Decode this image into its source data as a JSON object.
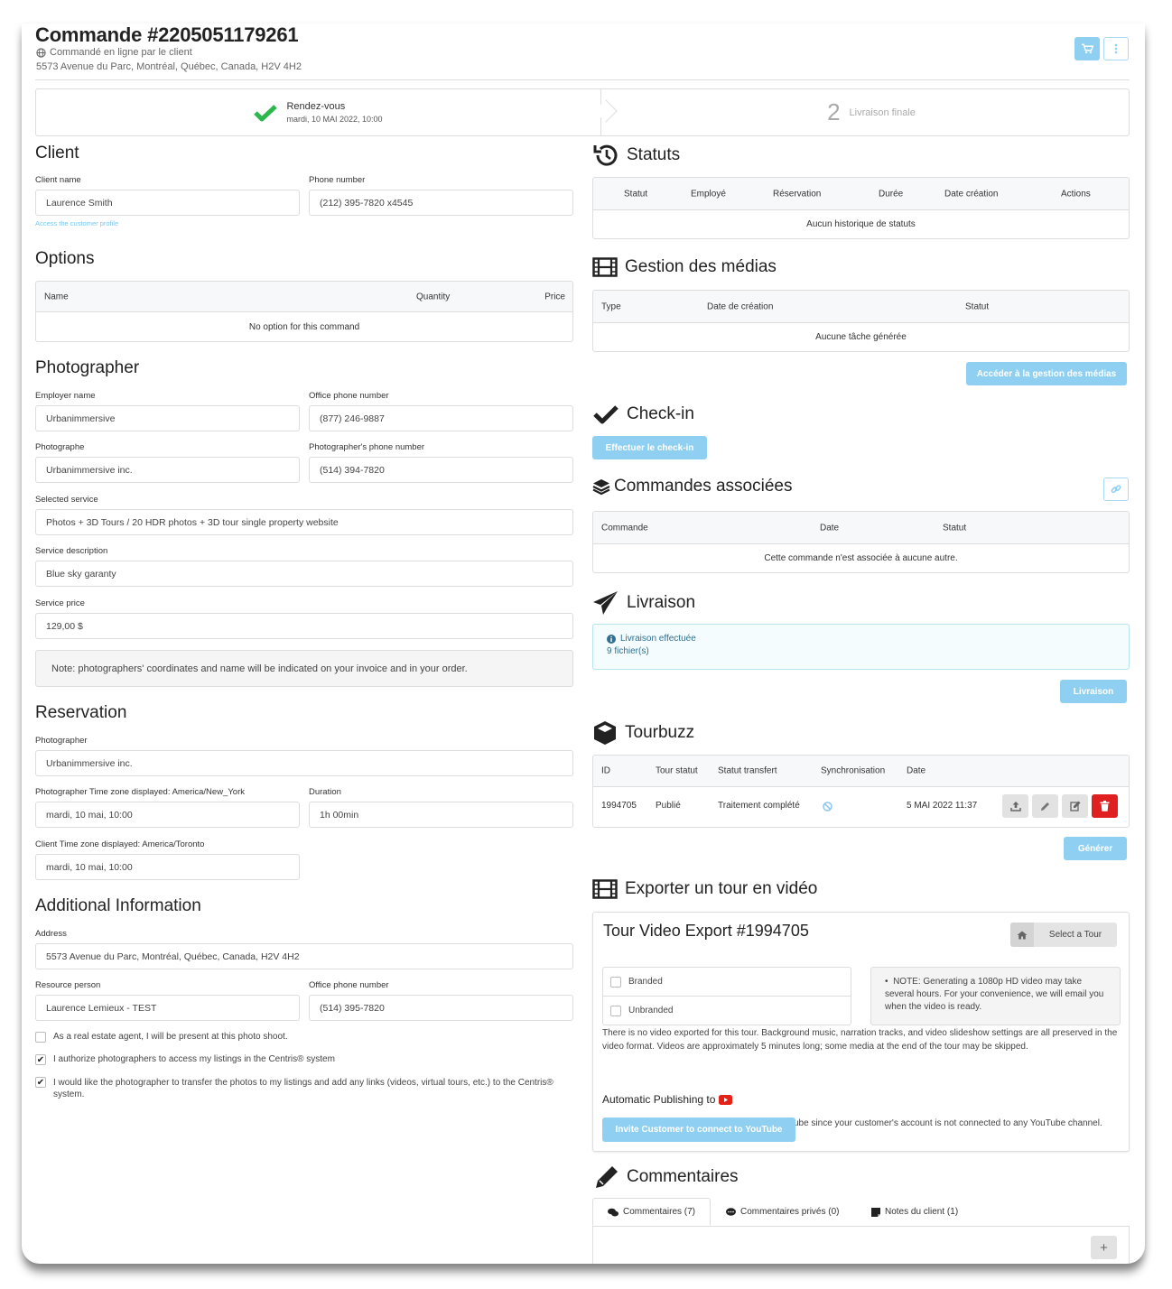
{
  "header": {
    "title": "Commande #2205051179261",
    "ordered_by": "Commandé en ligne par le client",
    "address": "5573 Avenue du Parc, Montréal, Québec, Canada, H2V 4H2",
    "icons": {
      "cart": "cart-icon",
      "more": "ellipsis-vertical-icon",
      "globe": "globe-icon"
    }
  },
  "steps": [
    {
      "label": "Rendez-vous",
      "date": "mardi, 10 MAI 2022, 10:00",
      "status": "done"
    },
    {
      "number": "2",
      "label": "Livraison finale",
      "status": "pending"
    }
  ],
  "client": {
    "heading": "Client",
    "name_label": "Client name",
    "name_value": "Laurence Smith",
    "phone_label": "Phone number",
    "phone_value": "(212) 395-7820 x4545",
    "profile_link": "Access the customer profile"
  },
  "options": {
    "heading": "Options",
    "columns": [
      "Name",
      "Quantity",
      "Price"
    ],
    "empty": "No option for this command"
  },
  "photographer": {
    "heading": "Photographer",
    "employer_label": "Employer name",
    "employer_value": "Urbanimmersive",
    "office_phone_label": "Office phone number",
    "office_phone_value": "(877) 246-9887",
    "photographe_label": "Photographe",
    "photographe_value": "Urbanimmersive inc.",
    "photographer_phone_label": "Photographer's phone number",
    "photographer_phone_value": "(514) 394-7820",
    "service_label": "Selected service",
    "service_value": "Photos + 3D Tours / 20 HDR photos + 3D tour single property website",
    "description_label": "Service description",
    "description_value": "Blue sky garanty",
    "price_label": "Service price",
    "price_value": "129,00 $",
    "note": "Note: photographers' coordinates and name will be indicated on your invoice and in your order."
  },
  "reservation": {
    "heading": "Reservation",
    "photographer_label": "Photographer",
    "photographer_value": "Urbanimmersive inc.",
    "photographer_tz_label": "Photographer Time zone displayed: America/New_York",
    "photographer_tz_value": "mardi, 10 mai, 10:00",
    "duration_label": "Duration",
    "duration_value": "1h 00min",
    "client_tz_label": "Client Time zone displayed: America/Toronto",
    "client_tz_value": "mardi, 10 mai, 10:00"
  },
  "additional": {
    "heading": "Additional Information",
    "address_label": "Address",
    "address_value": "5573 Avenue du Parc, Montréal, Québec, Canada, H2V 4H2",
    "resource_label": "Resource person",
    "resource_value": "Laurence Lemieux - TEST",
    "office_phone_label": "Office phone number",
    "office_phone_value": "(514) 395-7820",
    "checkboxes": [
      {
        "label": "As a real estate agent, I will be present at this photo shoot.",
        "checked": false
      },
      {
        "label": "I authorize photographers to access my listings in the Centris® system",
        "checked": true
      },
      {
        "label": "I would like the photographer to transfer the photos to my listings and add any links (videos, virtual tours, etc.) to the Centris® system.",
        "checked": true
      }
    ]
  },
  "statuts": {
    "heading": "Statuts",
    "columns": [
      "Statut",
      "Employé",
      "Réservation",
      "Durée",
      "Date création",
      "Actions"
    ],
    "empty": "Aucun historique de statuts"
  },
  "medias": {
    "heading": "Gestion des médias",
    "columns": [
      "Type",
      "Date de création",
      "Statut"
    ],
    "empty": "Aucune tâche générée",
    "button": "Accéder à la gestion des médias"
  },
  "checkin": {
    "heading": "Check-in",
    "button": "Effectuer le check-in"
  },
  "associated": {
    "heading": "Commandes associées",
    "columns": [
      "Commande",
      "Date",
      "Statut"
    ],
    "empty": "Cette commande n'est associée à aucune autre."
  },
  "livraison": {
    "heading": "Livraison",
    "status": "Livraison effectuée",
    "files": "9 fichier(s)",
    "button": "Livraison"
  },
  "tourbuzz": {
    "heading": "Tourbuzz",
    "columns": [
      "ID",
      "Tour statut",
      "Statut transfert",
      "Synchronisation",
      "Date"
    ],
    "rows": [
      {
        "id": "1994705",
        "tour_status": "Publié",
        "transfer_status": "Traitement complété",
        "sync": "ban-icon",
        "date": "5 MAI 2022 11:37"
      }
    ],
    "button": "Générer"
  },
  "export": {
    "heading": "Exporter un tour en vidéo",
    "title": "Tour Video Export #1994705",
    "select_tour": "Select a Tour",
    "options": [
      {
        "label": "Branded",
        "checked": false
      },
      {
        "label": "Unbranded",
        "checked": false
      }
    ],
    "note": "NOTE: Generating a 1080p HD video may take several hours. For your convenience, we will email you when the video is ready.",
    "info": "There is no video exported for this tour. Background music, narration tracks, and video slideshow settings are all preserved in the video format. Videos are approximately 5 minutes long; some media at the end of the tour may be skipped.",
    "publish_heading": "Automatic Publishing to",
    "publish_text": "This video will not be automatically sent to YouTube since your customer's account is not connected to any YouTube channel.",
    "invite_button": "Invite Customer to connect to YouTube"
  },
  "comments": {
    "heading": "Commentaires",
    "tabs": [
      {
        "label": "Commentaires (7)",
        "active": true
      },
      {
        "label": "Commentaires privés (0)",
        "active": false
      },
      {
        "label": "Notes du client (1)",
        "active": false
      }
    ],
    "add": "+"
  },
  "colors": {
    "accent_light": "#8fd0f2",
    "success": "#2db84d",
    "danger": "#e02020",
    "youtube": "#e62117"
  }
}
